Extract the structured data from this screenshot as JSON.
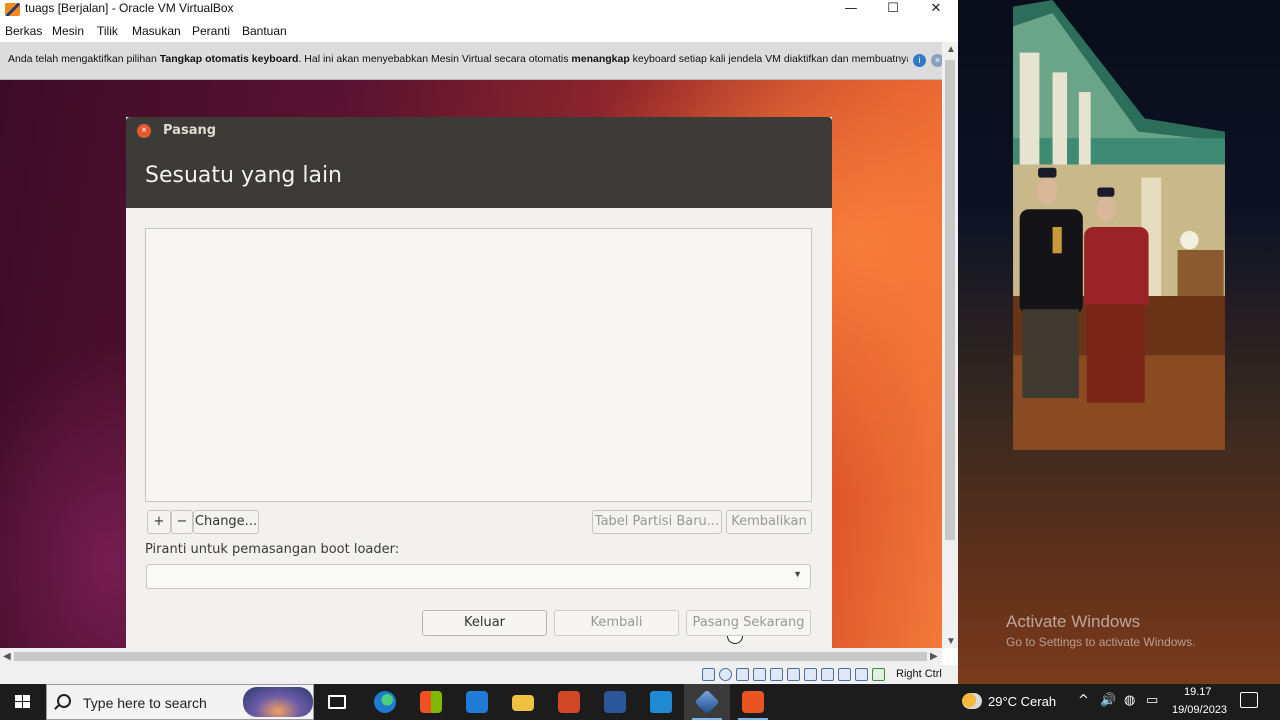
{
  "window": {
    "title": "tuags [Berjalan] - Oracle VM VirtualBox",
    "controls": {
      "minimize": "—",
      "maximize": "☐",
      "close": "✕"
    }
  },
  "menubar": {
    "items": [
      "Berkas",
      "Mesin",
      "Tilik",
      "Masukan",
      "Peranti",
      "Bantuan"
    ]
  },
  "notification": {
    "text_1": "Anda telah mengaktifkan pilihan ",
    "bold_1": "Tangkap otomatis keyboard",
    "text_2": ". Hal ini akan menyebabkan Mesin Virtual secara otomatis ",
    "bold_2": "menangkap",
    "text_3": " keyboard setiap kali jendela VM diaktifkan dan membuatnya"
  },
  "installer": {
    "window_title": "Pasang",
    "heading": "Sesuatu yang lain",
    "add_label": "+",
    "remove_label": "−",
    "change_label": "Change...",
    "new_table_label": "Tabel Partisi Baru...",
    "revert_label": "Kembalikan",
    "bootloader_label": "Piranti untuk pemasangan boot loader:",
    "bootloader_value": "",
    "quit_label": "Keluar",
    "back_label": "Kembali",
    "install_label": "Pasang Sekarang"
  },
  "statusbar": {
    "host_key": "Right Ctrl"
  },
  "watermark": {
    "title": "Activate Windows",
    "subtitle": "Go to Settings to activate Windows."
  },
  "taskbar": {
    "search_placeholder": "Type here to search",
    "weather": "29°C  Cerah",
    "time": "19.17",
    "date": "19/09/2023"
  },
  "colors": {
    "installer_header": "#3c3b37",
    "installer_close": "#e4592c",
    "taskbar": "#1c1c1c",
    "vm_accent": "#e0582c"
  },
  "icons": [
    "vbox-app-icon",
    "installer-close-icon",
    "windows-start-icon",
    "search-icon",
    "task-view-icon",
    "edge-icon",
    "store-icon",
    "mail-icon",
    "explorer-icon",
    "powerpoint-icon",
    "word-icon",
    "vscode-icon",
    "virtualbox-icon",
    "ubuntu-vm-icon",
    "weather-icon",
    "notification-center-icon"
  ]
}
